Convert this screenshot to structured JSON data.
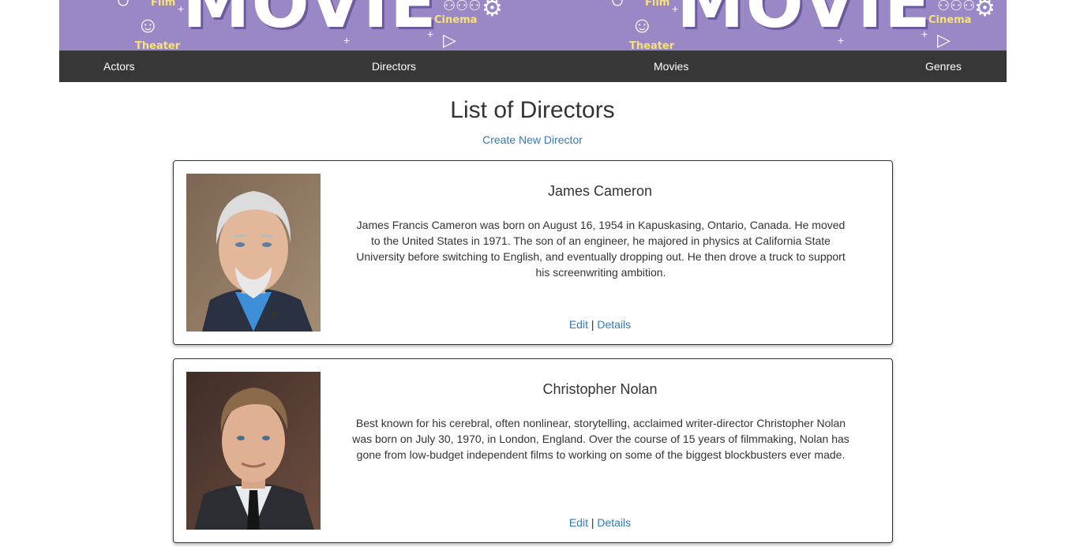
{
  "banner": {
    "word": "MOVIE",
    "tags": {
      "film": "Film",
      "theater": "Theater",
      "cinema": "Cinema"
    }
  },
  "nav": {
    "items": [
      {
        "label": "Actors"
      },
      {
        "label": "Directors"
      },
      {
        "label": "Movies"
      },
      {
        "label": "Genres"
      }
    ]
  },
  "main": {
    "title": "List of Directors",
    "create_label": "Create New Director"
  },
  "directors": [
    {
      "name": "James Cameron",
      "bio": "James Francis Cameron was born on August 16, 1954 in Kapuskasing, Ontario, Canada. He moved to the United States in 1971. The son of an engineer, he majored in physics at California State University before switching to English, and eventually dropping out. He then drove a truck to support his screenwriting ambition.",
      "edit_label": "Edit",
      "separator": "|",
      "details_label": "Details"
    },
    {
      "name": "Christopher Nolan",
      "bio": "Best known for his cerebral, often nonlinear, storytelling, acclaimed writer-director Christopher Nolan was born on July 30, 1970, in London, England. Over the course of 15 years of filmmaking, Nolan has gone from low-budget independent films to working on some of the biggest blockbusters ever made.",
      "edit_label": "Edit",
      "separator": "|",
      "details_label": "Details"
    }
  ],
  "colors": {
    "banner": "#9a88c6",
    "nav_bg": "#373737",
    "link": "#337ab7"
  }
}
